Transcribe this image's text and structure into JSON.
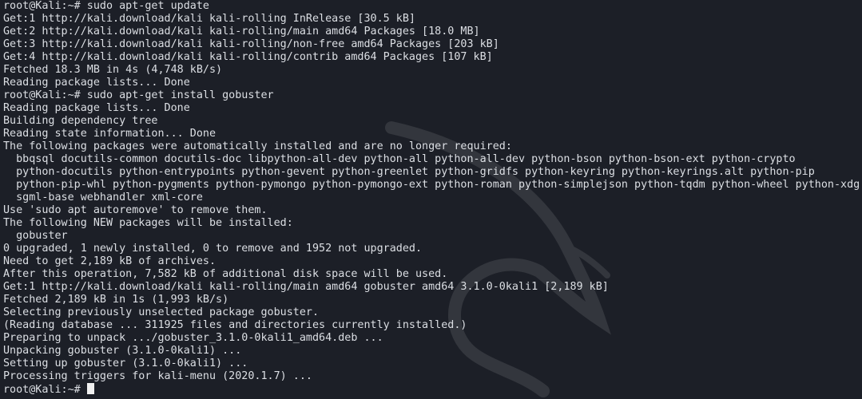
{
  "terminal": {
    "lines": [
      "root@Kali:~# sudo apt-get update",
      "Get:1 http://kali.download/kali kali-rolling InRelease [30.5 kB]",
      "Get:2 http://kali.download/kali kali-rolling/main amd64 Packages [18.0 MB]",
      "Get:3 http://kali.download/kali kali-rolling/non-free amd64 Packages [203 kB]",
      "Get:4 http://kali.download/kali kali-rolling/contrib amd64 Packages [107 kB]",
      "Fetched 18.3 MB in 4s (4,748 kB/s)",
      "Reading package lists... Done",
      "root@Kali:~# sudo apt-get install gobuster",
      "Reading package lists... Done",
      "Building dependency tree",
      "Reading state information... Done",
      "The following packages were automatically installed and are no longer required:",
      "  bbqsql docutils-common docutils-doc libpython-all-dev python-all python-all-dev python-bson python-bson-ext python-crypto",
      "  python-docutils python-entrypoints python-gevent python-greenlet python-gridfs python-keyring python-keyrings.alt python-pip",
      "  python-pip-whl python-pygments python-pymongo python-pymongo-ext python-roman python-simplejson python-tqdm python-wheel python-xdg",
      "  sgml-base webhandler xml-core",
      "Use 'sudo apt autoremove' to remove them.",
      "The following NEW packages will be installed:",
      "  gobuster",
      "0 upgraded, 1 newly installed, 0 to remove and 1952 not upgraded.",
      "Need to get 2,189 kB of archives.",
      "After this operation, 7,582 kB of additional disk space will be used.",
      "Get:1 http://kali.download/kali kali-rolling/main amd64 gobuster amd64 3.1.0-0kali1 [2,189 kB]",
      "Fetched 2,189 kB in 1s (1,993 kB/s)",
      "Selecting previously unselected package gobuster.",
      "(Reading database ... 311925 files and directories currently installed.)",
      "Preparing to unpack .../gobuster_3.1.0-0kali1_amd64.deb ...",
      "Unpacking gobuster (3.1.0-0kali1) ...",
      "Setting up gobuster (3.1.0-0kali1) ...",
      "Processing triggers for kali-menu (2020.1.7) ..."
    ],
    "prompt": "root@Kali:~# "
  },
  "colors": {
    "background": "#1c1f27",
    "text": "#dcdfe4",
    "cursor": "#f0f0f0"
  },
  "icons": {
    "watermark": "kali-dragon-icon"
  }
}
